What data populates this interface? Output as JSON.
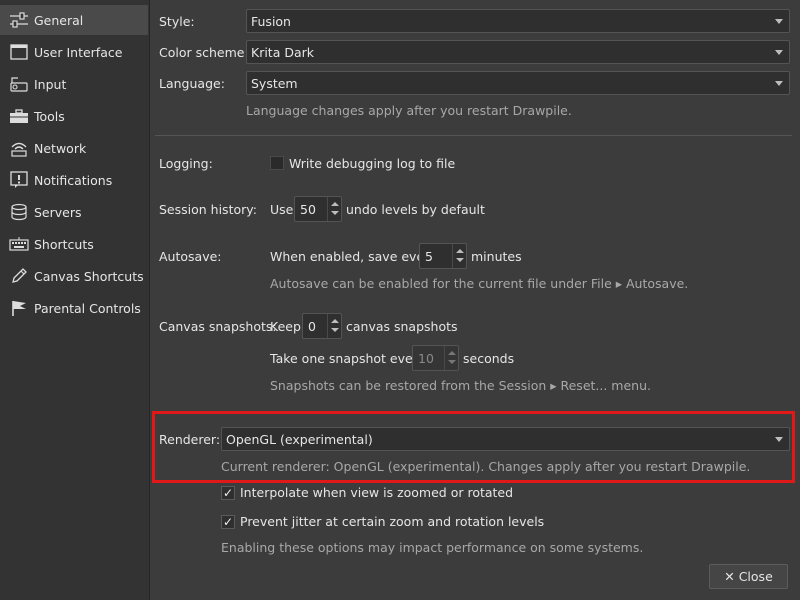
{
  "sidebar": {
    "items": [
      {
        "label": "General",
        "icon": "sliders-icon",
        "selected": true
      },
      {
        "label": "User Interface",
        "icon": "window-icon"
      },
      {
        "label": "Input",
        "icon": "input-device-icon"
      },
      {
        "label": "Tools",
        "icon": "toolbox-icon"
      },
      {
        "label": "Network",
        "icon": "network-icon"
      },
      {
        "label": "Notifications",
        "icon": "notification-icon"
      },
      {
        "label": "Servers",
        "icon": "database-icon"
      },
      {
        "label": "Shortcuts",
        "icon": "keyboard-icon"
      },
      {
        "label": "Canvas Shortcuts",
        "icon": "pen-icon"
      },
      {
        "label": "Parental Controls",
        "icon": "flag-icon"
      }
    ]
  },
  "style": {
    "label": "Style:",
    "value": "Fusion"
  },
  "color_scheme": {
    "label": "Color scheme:",
    "value": "Krita Dark"
  },
  "language": {
    "label": "Language:",
    "value": "System",
    "note": "Language changes apply after you restart Drawpile."
  },
  "logging": {
    "label": "Logging:",
    "checkbox_label": "Write debugging log to file",
    "checked": false
  },
  "session_history": {
    "label": "Session history:",
    "prefix": "Use",
    "value": "50",
    "suffix": "undo levels by default"
  },
  "autosave": {
    "label": "Autosave:",
    "prefix": "When enabled, save every",
    "value": "5",
    "suffix": "minutes",
    "note": "Autosave can be enabled for the current file under File ▸ Autosave."
  },
  "canvas_snapshots": {
    "label": "Canvas snapshots:",
    "keep_prefix": "Keep",
    "keep_value": "0",
    "keep_suffix": "canvas snapshots",
    "every_prefix": "Take one snapshot every",
    "every_value": "10",
    "every_suffix": "seconds",
    "note": "Snapshots can be restored from the Session ▸ Reset... menu."
  },
  "renderer": {
    "label": "Renderer:",
    "value": "OpenGL (experimental)",
    "note": "Current renderer: OpenGL (experimental). Changes apply after you restart Drawpile."
  },
  "interpolate": {
    "label": "Interpolate when view is zoomed or rotated",
    "checked": true
  },
  "prevent_jitter": {
    "label": "Prevent jitter at certain zoom and rotation levels",
    "checked": true
  },
  "performance_note": "Enabling these options may impact performance on some systems.",
  "close_button": {
    "label": "Close"
  },
  "colors": {
    "highlight": "#e01818",
    "selected_bg": "#4a4a4a",
    "background": "#3c3c3c"
  }
}
